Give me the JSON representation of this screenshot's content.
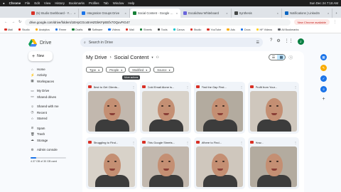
{
  "mac_menu": {
    "app": "Chrome",
    "items": [
      "File",
      "Edit",
      "View",
      "History",
      "Bookmarks",
      "Profiles",
      "Tab",
      "Window",
      "Help"
    ],
    "clock": "Sun Dec 24  7:18 AM"
  },
  "tabs": [
    {
      "label": "(5) Studio Dashboard - YouTube",
      "color": "#d93025",
      "active": false
    },
    {
      "label": "Integration Groups Drive",
      "color": "#1a73e8",
      "active": false
    },
    {
      "label": "Social Content - Google Drive",
      "color": "#188038",
      "active": true
    },
    {
      "label": "Excalidraw Whiteboard",
      "color": "#6965db",
      "active": false
    },
    {
      "label": "Synthesis",
      "color": "#444746",
      "active": false
    },
    {
      "label": "Notifications | LinkedIn",
      "color": "#0a66c2",
      "active": false
    }
  ],
  "address_bar": {
    "url": "drive.google.com/drive/folders/1EHpCGcxtInHZGkKFpEEfx7OQuvFIG47",
    "update_label": "New Chrome available"
  },
  "bookmarks": [
    {
      "label": "Mail",
      "color": "#d93025"
    },
    {
      "label": "Studio",
      "color": "#d93025"
    },
    {
      "label": "Analytics",
      "color": "#f9ab00"
    },
    {
      "label": "Rmmr",
      "color": "#1a73e8"
    },
    {
      "label": "Drafts",
      "color": "#188038"
    },
    {
      "label": "Software",
      "color": "#5f6368"
    },
    {
      "label": "Videos",
      "color": "#1a73e8"
    },
    {
      "label": "Mail",
      "color": "#d93025"
    },
    {
      "label": "Sheets",
      "color": "#188038"
    },
    {
      "label": "Tools",
      "color": "#444746"
    },
    {
      "label": "Canva",
      "color": "#00c4cc"
    },
    {
      "label": "Studio",
      "color": "#d93025"
    },
    {
      "label": "YouTube",
      "color": "#d93025"
    },
    {
      "label": "Ads",
      "color": "#f9ab00"
    },
    {
      "label": "Docs",
      "color": "#1a73e8"
    },
    {
      "label": "HF Videos",
      "color": "#ffd21e"
    },
    {
      "label": "All Bookmarks",
      "color": "#5f6368"
    }
  ],
  "drive": {
    "logo": "Drive",
    "search_placeholder": "Search in Drive",
    "account_initial": "J"
  },
  "sidebar": {
    "new_label": "New",
    "items": [
      {
        "label": "Home",
        "icon": "home-icon",
        "glyph": "⌂"
      },
      {
        "label": "Activity",
        "icon": "activity-icon",
        "glyph": "⚡"
      },
      {
        "label": "Workspaces",
        "icon": "workspaces-icon",
        "glyph": "▦"
      },
      {
        "label": "My Drive",
        "icon": "my-drive-icon",
        "glyph": "▭"
      },
      {
        "label": "Shared drives",
        "icon": "shared-drives-icon",
        "glyph": "▭"
      },
      {
        "label": "Shared with me",
        "icon": "shared-with-me-icon",
        "glyph": "☺"
      },
      {
        "label": "Recent",
        "icon": "clock-icon",
        "glyph": "◷"
      },
      {
        "label": "Starred",
        "icon": "star-icon",
        "glyph": "☆"
      },
      {
        "label": "Spam",
        "icon": "spam-icon",
        "glyph": "⊘"
      },
      {
        "label": "Trash",
        "icon": "trash-icon",
        "glyph": "🗑"
      },
      {
        "label": "Storage",
        "icon": "cloud-icon",
        "glyph": "☁"
      },
      {
        "label": "Admin console",
        "icon": "admin-icon",
        "glyph": "⚙"
      }
    ],
    "storage_text": "4.37 GB of 30 GB used",
    "storage_fraction": 0.15
  },
  "main": {
    "breadcrumb_root": "My Drive",
    "breadcrumb_folder": "Social Content",
    "filters": [
      "Type",
      "People",
      "Modified",
      "Source"
    ],
    "tooltip": "More actions",
    "files": [
      {
        "title": "Best to Get Clients...",
        "thumb": "a"
      },
      {
        "title": "Cold Email Alone is...",
        "thumb": "b"
      },
      {
        "title": "Find the Gap First...",
        "thumb": "c"
      },
      {
        "title": "Profit from Your...",
        "thumb": "d"
      },
      {
        "title": "Struggling to Find...",
        "thumb": "b"
      },
      {
        "title": "This Google Sheets...",
        "thumb": "a"
      },
      {
        "title": "Where to Find...",
        "thumb": "d"
      },
      {
        "title": "How...",
        "thumb": "c"
      }
    ]
  },
  "right_panel": [
    {
      "icon": "calendar-icon",
      "color": "#1a73e8",
      "glyph": "▦"
    },
    {
      "icon": "keep-icon",
      "color": "#f9ab00",
      "glyph": "✎"
    },
    {
      "icon": "tasks-icon",
      "color": "#1a73e8",
      "glyph": "✓"
    },
    {
      "icon": "contacts-icon",
      "color": "#1a73e8",
      "glyph": "☺"
    }
  ]
}
